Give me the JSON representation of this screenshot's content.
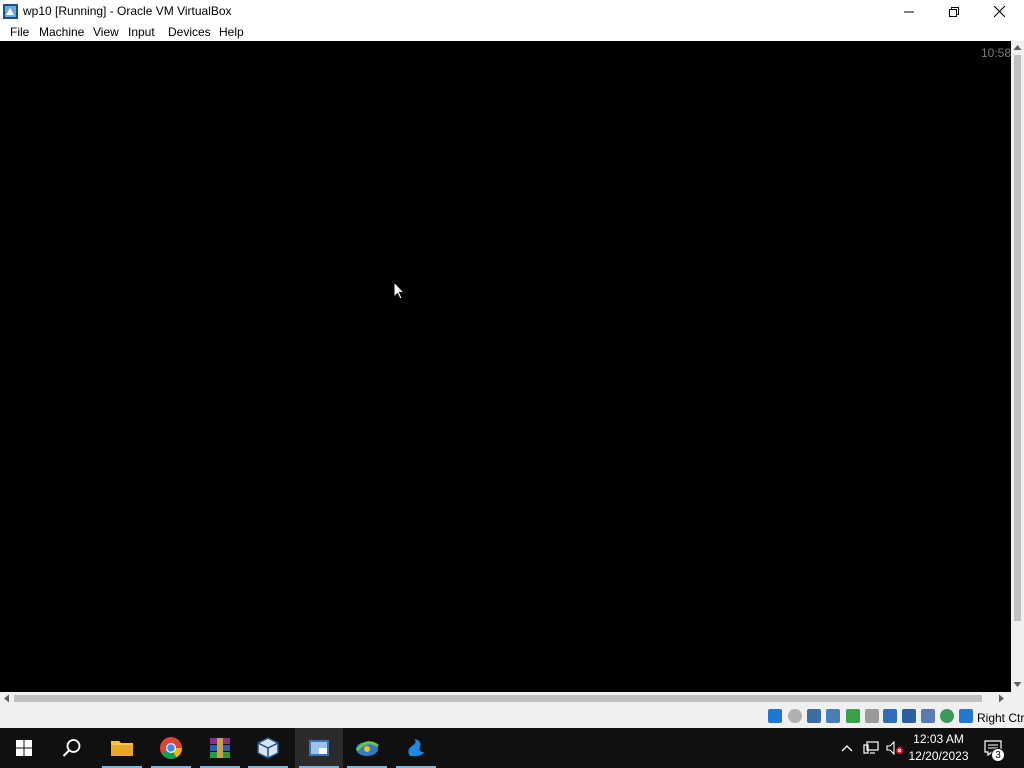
{
  "window": {
    "title": "wp10 [Running] - Oracle VM VirtualBox",
    "icon": "virtualbox-icon"
  },
  "menu": {
    "items": [
      "File",
      "Machine",
      "View",
      "Input",
      "Devices",
      "Help"
    ]
  },
  "vm": {
    "clock": "10:58"
  },
  "statusbar": {
    "icons": [
      "hard-disk-icon",
      "optical-drive-icon",
      "audio-icon",
      "network-icon",
      "usb-icon",
      "shared-folders-icon",
      "display-icon",
      "video-capture-icon",
      "graphics-icon",
      "cpu-icon",
      "mouse-integration-icon",
      "keyboard-capture-icon"
    ],
    "host_key": "Right Ctrl"
  },
  "taskbar": {
    "apps": [
      "start-icon",
      "search-icon",
      "file-explorer-icon",
      "chrome-icon",
      "winrar-icon",
      "virtualbox-icon",
      "vm-window-icon",
      "idm-icon",
      "swan-app-icon"
    ],
    "active_app": "vm-window-icon",
    "tray": {
      "time": "12:03 AM",
      "date": "12/20/2023",
      "notification_count": "3"
    }
  },
  "colors": {
    "taskbar_bg": "#101010",
    "accent": "#76b9ed",
    "vm_bg": "#000000"
  }
}
